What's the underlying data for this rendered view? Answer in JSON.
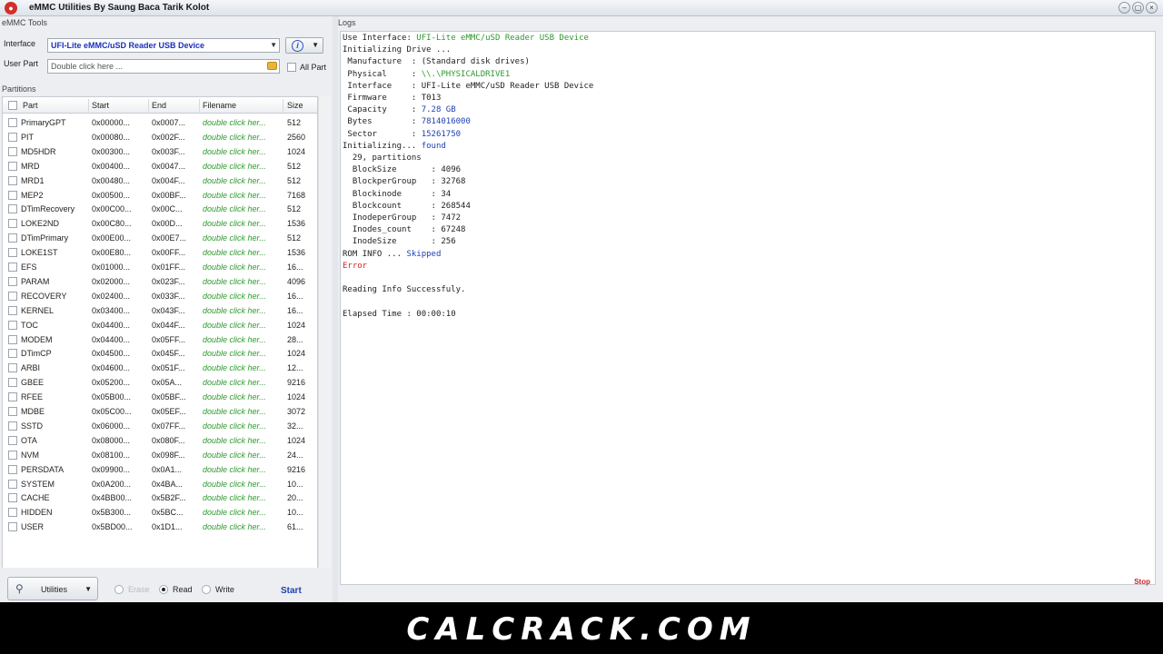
{
  "window": {
    "title": "eMMC Utilities  By Saung Baca Tarik Kolot",
    "minimize": "–",
    "maximize": "▢",
    "close": "×"
  },
  "tools": {
    "caption": "eMMC Tools",
    "interface_label": "Interface",
    "interface_value": "UFI-Lite eMMC/uSD Reader USB Device",
    "user_part_label": "User Part",
    "user_part_value": "Double click here ...",
    "all_part_label": "All Part"
  },
  "partitions": {
    "caption": "Partitions",
    "headers": {
      "part": "Part",
      "start": "Start",
      "end": "End",
      "filename": "Filename",
      "size": "Size"
    },
    "rows": [
      {
        "part": "PrimaryGPT",
        "start": "0x00000...",
        "end": "0x0007...",
        "filename": "double click her...",
        "size": "512"
      },
      {
        "part": "PIT",
        "start": "0x00080...",
        "end": "0x002F...",
        "filename": "double click her...",
        "size": "2560"
      },
      {
        "part": "MD5HDR",
        "start": "0x00300...",
        "end": "0x003F...",
        "filename": "double click her...",
        "size": "1024"
      },
      {
        "part": "MRD",
        "start": "0x00400...",
        "end": "0x0047...",
        "filename": "double click her...",
        "size": "512"
      },
      {
        "part": "MRD1",
        "start": "0x00480...",
        "end": "0x004F...",
        "filename": "double click her...",
        "size": "512"
      },
      {
        "part": "MEP2",
        "start": "0x00500...",
        "end": "0x00BF...",
        "filename": "double click her...",
        "size": "7168"
      },
      {
        "part": "DTimRecovery",
        "start": "0x00C00...",
        "end": "0x00C...",
        "filename": "double click her...",
        "size": "512"
      },
      {
        "part": "LOKE2ND",
        "start": "0x00C80...",
        "end": "0x00D...",
        "filename": "double click her...",
        "size": "1536"
      },
      {
        "part": "DTimPrimary",
        "start": "0x00E00...",
        "end": "0x00E7...",
        "filename": "double click her...",
        "size": "512"
      },
      {
        "part": "LOKE1ST",
        "start": "0x00E80...",
        "end": "0x00FF...",
        "filename": "double click her...",
        "size": "1536"
      },
      {
        "part": "EFS",
        "start": "0x01000...",
        "end": "0x01FF...",
        "filename": "double click her...",
        "size": "16..."
      },
      {
        "part": "PARAM",
        "start": "0x02000...",
        "end": "0x023F...",
        "filename": "double click her...",
        "size": "4096"
      },
      {
        "part": "RECOVERY",
        "start": "0x02400...",
        "end": "0x033F...",
        "filename": "double click her...",
        "size": "16..."
      },
      {
        "part": "KERNEL",
        "start": "0x03400...",
        "end": "0x043F...",
        "filename": "double click her...",
        "size": "16..."
      },
      {
        "part": "TOC",
        "start": "0x04400...",
        "end": "0x044F...",
        "filename": "double click her...",
        "size": "1024"
      },
      {
        "part": "MODEM",
        "start": "0x04400...",
        "end": "0x05FF...",
        "filename": "double click her...",
        "size": "28..."
      },
      {
        "part": "DTimCP",
        "start": "0x04500...",
        "end": "0x045F...",
        "filename": "double click her...",
        "size": "1024"
      },
      {
        "part": "ARBI",
        "start": "0x04600...",
        "end": "0x051F...",
        "filename": "double click her...",
        "size": "12..."
      },
      {
        "part": "GBEE",
        "start": "0x05200...",
        "end": "0x05A...",
        "filename": "double click her...",
        "size": "9216"
      },
      {
        "part": "RFEE",
        "start": "0x05B00...",
        "end": "0x05BF...",
        "filename": "double click her...",
        "size": "1024"
      },
      {
        "part": "MDBE",
        "start": "0x05C00...",
        "end": "0x05EF...",
        "filename": "double click her...",
        "size": "3072"
      },
      {
        "part": "SSTD",
        "start": "0x06000...",
        "end": "0x07FF...",
        "filename": "double click her...",
        "size": "32..."
      },
      {
        "part": "OTA",
        "start": "0x08000...",
        "end": "0x080F...",
        "filename": "double click her...",
        "size": "1024"
      },
      {
        "part": "NVM",
        "start": "0x08100...",
        "end": "0x098F...",
        "filename": "double click her...",
        "size": "24..."
      },
      {
        "part": "PERSDATA",
        "start": "0x09900...",
        "end": "0x0A1...",
        "filename": "double click her...",
        "size": "9216"
      },
      {
        "part": "SYSTEM",
        "start": "0x0A200...",
        "end": "0x4BA...",
        "filename": "double click her...",
        "size": "10..."
      },
      {
        "part": "CACHE",
        "start": "0x4BB00...",
        "end": "0x5B2F...",
        "filename": "double click her...",
        "size": "20..."
      },
      {
        "part": "HIDDEN",
        "start": "0x5B300...",
        "end": "0x5BC...",
        "filename": "double click her...",
        "size": "10..."
      },
      {
        "part": "USER",
        "start": "0x5BD00...",
        "end": "0x1D1...",
        "filename": "double click her...",
        "size": "61..."
      }
    ]
  },
  "bottom": {
    "utilities_label": "Utilities",
    "erase_label": "Erase",
    "read_label": "Read",
    "write_label": "Write",
    "start_label": "Start",
    "selected_mode": "Read"
  },
  "logs": {
    "caption": "Logs",
    "lines": [
      [
        {
          "t": "Use Interface: "
        },
        {
          "t": "UFI-Lite eMMC/uSD Reader USB Device",
          "c": "green"
        }
      ],
      [
        {
          "t": "Initializing Drive ..."
        }
      ],
      [
        {
          "t": " Manufacture  : (Standard disk drives)"
        }
      ],
      [
        {
          "t": " Physical     : "
        },
        {
          "t": "\\\\.\\PHYSICALDRIVE1",
          "c": "green"
        }
      ],
      [
        {
          "t": " Interface    : UFI-Lite eMMC/uSD Reader USB Device"
        }
      ],
      [
        {
          "t": " Firmware     : T013"
        }
      ],
      [
        {
          "t": " Capacity     : "
        },
        {
          "t": "7.28 GB",
          "c": "blue"
        }
      ],
      [
        {
          "t": " Bytes        : "
        },
        {
          "t": "7814016000",
          "c": "blue"
        }
      ],
      [
        {
          "t": " Sector       : "
        },
        {
          "t": "15261750",
          "c": "blue"
        }
      ],
      [
        {
          "t": "Initializing... "
        },
        {
          "t": "found",
          "c": "blue"
        }
      ],
      [
        {
          "t": "  29, partitions"
        }
      ],
      [
        {
          "t": "  BlockSize       : 4096"
        }
      ],
      [
        {
          "t": "  BlockperGroup   : 32768"
        }
      ],
      [
        {
          "t": "  Blockinode      : 34"
        }
      ],
      [
        {
          "t": "  Blockcount      : 268544"
        }
      ],
      [
        {
          "t": "  InodeperGroup   : 7472"
        }
      ],
      [
        {
          "t": "  Inodes_count    : 67248"
        }
      ],
      [
        {
          "t": "  InodeSize       : 256"
        }
      ],
      [
        {
          "t": "ROM INFO ... "
        },
        {
          "t": "Skipped",
          "c": "blue"
        }
      ],
      [
        {
          "t": "Error",
          "c": "red"
        }
      ],
      [
        {
          "t": ""
        }
      ],
      [
        {
          "t": "Reading Info Successfuly."
        }
      ],
      [
        {
          "t": ""
        }
      ],
      [
        {
          "t": "Elapsed Time : 00:00:10"
        }
      ]
    ],
    "status": "Stop"
  },
  "footer": {
    "watermark": "CALCRACK.COM"
  },
  "colors": {
    "accent_blue": "#1f3fb5",
    "log_green": "#2e9a2e",
    "error_red": "#d32222",
    "footer_bg": "#000000"
  }
}
